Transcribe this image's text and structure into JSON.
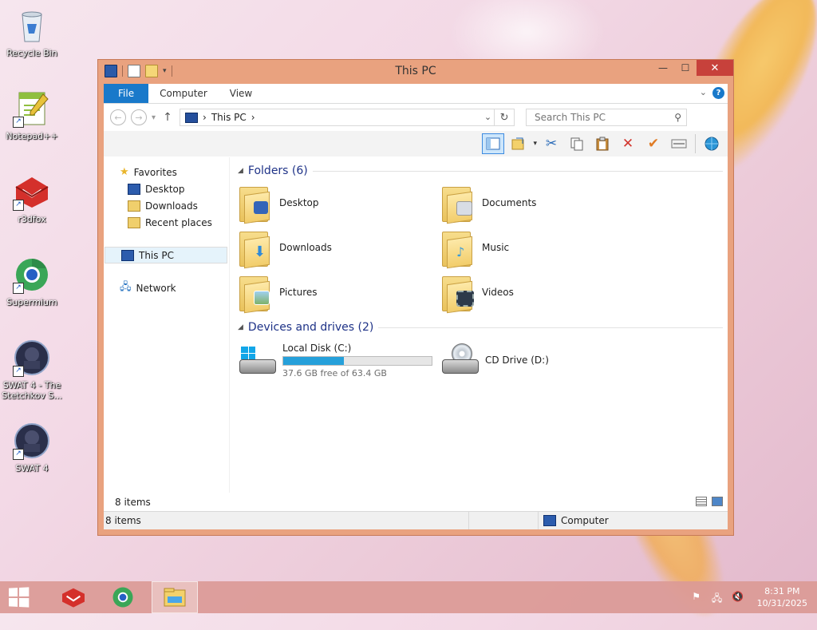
{
  "desktop": {
    "icons": [
      {
        "label": "Recycle Bin",
        "icon": "recycle-bin-icon"
      },
      {
        "label": "Notepad++",
        "icon": "notepadpp-icon"
      },
      {
        "label": "r3dfox",
        "icon": "r3dfox-icon"
      },
      {
        "label": "Supermium",
        "icon": "supermium-icon"
      },
      {
        "label": "SWAT 4 - The Stetchkov S...",
        "icon": "swat4-stetchkov-icon"
      },
      {
        "label": "SWAT 4",
        "icon": "swat4-icon"
      }
    ]
  },
  "window": {
    "title": "This PC",
    "caption": {
      "minimize": "—",
      "maximize": "☐",
      "close": "✕"
    },
    "ribbon_tabs": [
      "File",
      "Computer",
      "View"
    ],
    "help": "?",
    "address": {
      "crumb": "This PC",
      "arrow": "›"
    },
    "search": {
      "placeholder": "Search This PC"
    },
    "nav": {
      "favorites": "Favorites",
      "favorites_children": [
        "Desktop",
        "Downloads",
        "Recent places"
      ],
      "this_pc": "This PC",
      "network": "Network"
    },
    "groups": {
      "folders_title": "Folders (6)",
      "folders": [
        {
          "name": "Desktop",
          "badge_color": "#3465b8"
        },
        {
          "name": "Documents",
          "badge_color": "#d8dde5"
        },
        {
          "name": "Downloads",
          "badge_color": "#2f8ad8"
        },
        {
          "name": "Music",
          "badge_color": "#3a9bd8"
        },
        {
          "name": "Pictures",
          "badge_color": "#7fb26a"
        },
        {
          "name": "Videos",
          "badge_color": "#2d3a4a"
        }
      ],
      "drives_title": "Devices and drives (2)",
      "drives": [
        {
          "name": "Local Disk (C:)",
          "free_text": "37.6 GB free of 63.4 GB",
          "used_fraction": 0.407
        },
        {
          "name": "CD Drive (D:)"
        }
      ]
    },
    "item_count": "8 items",
    "status": {
      "left": "8 items",
      "right": "Computer"
    }
  },
  "taskbar": {
    "apps": [
      "r3dfox",
      "Supermium",
      "File Explorer"
    ],
    "time": "8:31 PM",
    "date": "10/31/2025"
  }
}
